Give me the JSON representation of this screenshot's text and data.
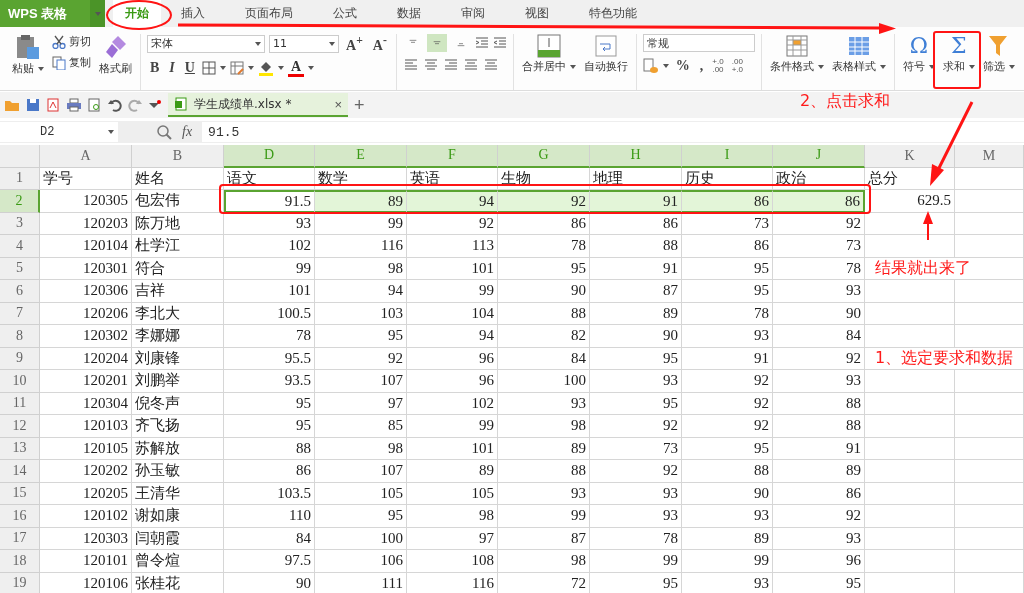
{
  "app_menu": {
    "label": "WPS 表格"
  },
  "ribbon_tabs": [
    {
      "label": "开始",
      "selected": true
    },
    {
      "label": "插入",
      "selected": false
    },
    {
      "label": "页面布局",
      "selected": false
    },
    {
      "label": "公式",
      "selected": false
    },
    {
      "label": "数据",
      "selected": false
    },
    {
      "label": "审阅",
      "selected": false
    },
    {
      "label": "视图",
      "selected": false
    },
    {
      "label": "特色功能",
      "selected": false
    }
  ],
  "ribbon": {
    "paste": "粘贴",
    "cut": "剪切",
    "copy": "复制",
    "format_painter": "格式刷",
    "font_name": "宋体",
    "font_size": "11",
    "grow_font": "A$^{+}$",
    "shrink_font": "A$^{-}$",
    "style_buttons": [
      "B",
      "I",
      "U"
    ],
    "font_color_glyph": "A",
    "vertical_align": [
      {
        "selected": false
      },
      {
        "selected": true
      },
      {
        "selected": false
      }
    ],
    "merge_center": "合并居中",
    "wrap_text": "自动换行",
    "number_format": "常规",
    "percent": "%",
    "comma": ",",
    "decimals": [
      {
        "top": "+.0",
        "bottom": ".00"
      },
      {
        "top": ".00",
        "bottom": "+.0"
      }
    ],
    "conditional_format": "条件格式",
    "table_style": "表格样式",
    "symbol_glyph": "Ω",
    "symbol": "符号",
    "sum_glyph": "Σ",
    "sum": "求和",
    "filter": "筛选"
  },
  "document_tab": {
    "title": "学生成绩单.xlsx *",
    "close": "×",
    "new_tab": "+"
  },
  "formula_bar": {
    "name_box": "D2",
    "fx": "fx",
    "value": "91.5"
  },
  "sheet": {
    "columns": [
      {
        "letter": "A",
        "kind": "number",
        "selected": false
      },
      {
        "letter": "B",
        "kind": "text",
        "selected": false
      },
      {
        "letter": "D",
        "kind": "number",
        "selected": true
      },
      {
        "letter": "E",
        "kind": "number",
        "selected": true
      },
      {
        "letter": "F",
        "kind": "number",
        "selected": true
      },
      {
        "letter": "G",
        "kind": "number",
        "selected": true
      },
      {
        "letter": "H",
        "kind": "number",
        "selected": true
      },
      {
        "letter": "I",
        "kind": "number",
        "selected": true
      },
      {
        "letter": "J",
        "kind": "number",
        "selected": true
      },
      {
        "letter": "K",
        "kind": "number",
        "selected": false
      },
      {
        "letter": "M",
        "kind": "number",
        "selected": false
      }
    ],
    "rows": [
      {
        "number": "1",
        "kind": "header",
        "selected": false,
        "cells": [
          "学号",
          "姓名",
          "语文",
          "数学",
          "英语",
          "生物",
          "地理",
          "历史",
          "政治",
          "总分"
        ]
      },
      {
        "number": "2",
        "kind": "data",
        "selected": true,
        "cells": [
          "120305",
          "包宏伟",
          "91.5",
          "89",
          "94",
          "92",
          "91",
          "86",
          "86",
          "629.5"
        ]
      },
      {
        "number": "3",
        "kind": "data",
        "selected": false,
        "cells": [
          "120203",
          "陈万地",
          "93",
          "99",
          "92",
          "86",
          "86",
          "73",
          "92"
        ]
      },
      {
        "number": "4",
        "kind": "data",
        "selected": false,
        "cells": [
          "120104",
          "杜学江",
          "102",
          "116",
          "113",
          "78",
          "88",
          "86",
          "73"
        ]
      },
      {
        "number": "5",
        "kind": "data",
        "selected": false,
        "cells": [
          "120301",
          "符合",
          "99",
          "98",
          "101",
          "95",
          "91",
          "95",
          "78"
        ]
      },
      {
        "number": "6",
        "kind": "data",
        "selected": false,
        "cells": [
          "120306",
          "吉祥",
          "101",
          "94",
          "99",
          "90",
          "87",
          "95",
          "93"
        ]
      },
      {
        "number": "7",
        "kind": "data",
        "selected": false,
        "cells": [
          "120206",
          "李北大",
          "100.5",
          "103",
          "104",
          "88",
          "89",
          "78",
          "90"
        ]
      },
      {
        "number": "8",
        "kind": "data",
        "selected": false,
        "cells": [
          "120302",
          "李娜娜",
          "78",
          "95",
          "94",
          "82",
          "90",
          "93",
          "84"
        ]
      },
      {
        "number": "9",
        "kind": "data",
        "selected": false,
        "cells": [
          "120204",
          "刘康锋",
          "95.5",
          "92",
          "96",
          "84",
          "95",
          "91",
          "92"
        ]
      },
      {
        "number": "10",
        "kind": "data",
        "selected": false,
        "cells": [
          "120201",
          "刘鹏举",
          "93.5",
          "107",
          "96",
          "100",
          "93",
          "92",
          "93"
        ]
      },
      {
        "number": "11",
        "kind": "data",
        "selected": false,
        "cells": [
          "120304",
          "倪冬声",
          "95",
          "97",
          "102",
          "93",
          "95",
          "92",
          "88"
        ]
      },
      {
        "number": "12",
        "kind": "data",
        "selected": false,
        "cells": [
          "120103",
          "齐飞扬",
          "95",
          "85",
          "99",
          "98",
          "92",
          "92",
          "88"
        ]
      },
      {
        "number": "13",
        "kind": "data",
        "selected": false,
        "cells": [
          "120105",
          "苏解放",
          "88",
          "98",
          "101",
          "89",
          "73",
          "95",
          "91"
        ]
      },
      {
        "number": "14",
        "kind": "data",
        "selected": false,
        "cells": [
          "120202",
          "孙玉敏",
          "86",
          "107",
          "89",
          "88",
          "92",
          "88",
          "89"
        ]
      },
      {
        "number": "15",
        "kind": "data",
        "selected": false,
        "cells": [
          "120205",
          "王清华",
          "103.5",
          "105",
          "105",
          "93",
          "93",
          "90",
          "86"
        ]
      },
      {
        "number": "16",
        "kind": "data",
        "selected": false,
        "cells": [
          "120102",
          "谢如康",
          "110",
          "95",
          "98",
          "99",
          "93",
          "93",
          "92"
        ]
      },
      {
        "number": "17",
        "kind": "data",
        "selected": false,
        "cells": [
          "120303",
          "闫朝霞",
          "84",
          "100",
          "97",
          "87",
          "78",
          "89",
          "93"
        ]
      },
      {
        "number": "18",
        "kind": "data",
        "selected": false,
        "cells": [
          "120101",
          "曾令煊",
          "97.5",
          "106",
          "108",
          "98",
          "99",
          "99",
          "96"
        ]
      },
      {
        "number": "19",
        "kind": "data",
        "selected": false,
        "cells": [
          "120106",
          "张桂花",
          "90",
          "111",
          "116",
          "72",
          "95",
          "93",
          "95"
        ]
      }
    ]
  },
  "annotations": [
    {
      "text": "2、点击求和"
    },
    {
      "text": "结果就出来了"
    },
    {
      "text": "1、选定要求和数据"
    }
  ]
}
